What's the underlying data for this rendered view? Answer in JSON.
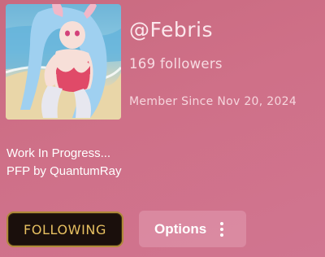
{
  "profile": {
    "username": "@Febris",
    "followers": "169 followers",
    "member_since": "Member Since Nov 20, 2024",
    "bio_lines": [
      "Work In Progress...",
      "PFP by QuantumRay"
    ]
  },
  "actions": {
    "following_label": "FOLLOWING",
    "options_label": "Options"
  },
  "icons": {
    "options_icon": "more-vertical-icon"
  },
  "colors": {
    "background": "#cf7088",
    "following_text": "#e7c061",
    "following_border": "#b08a3a",
    "following_bg": "#1a0f0c"
  }
}
